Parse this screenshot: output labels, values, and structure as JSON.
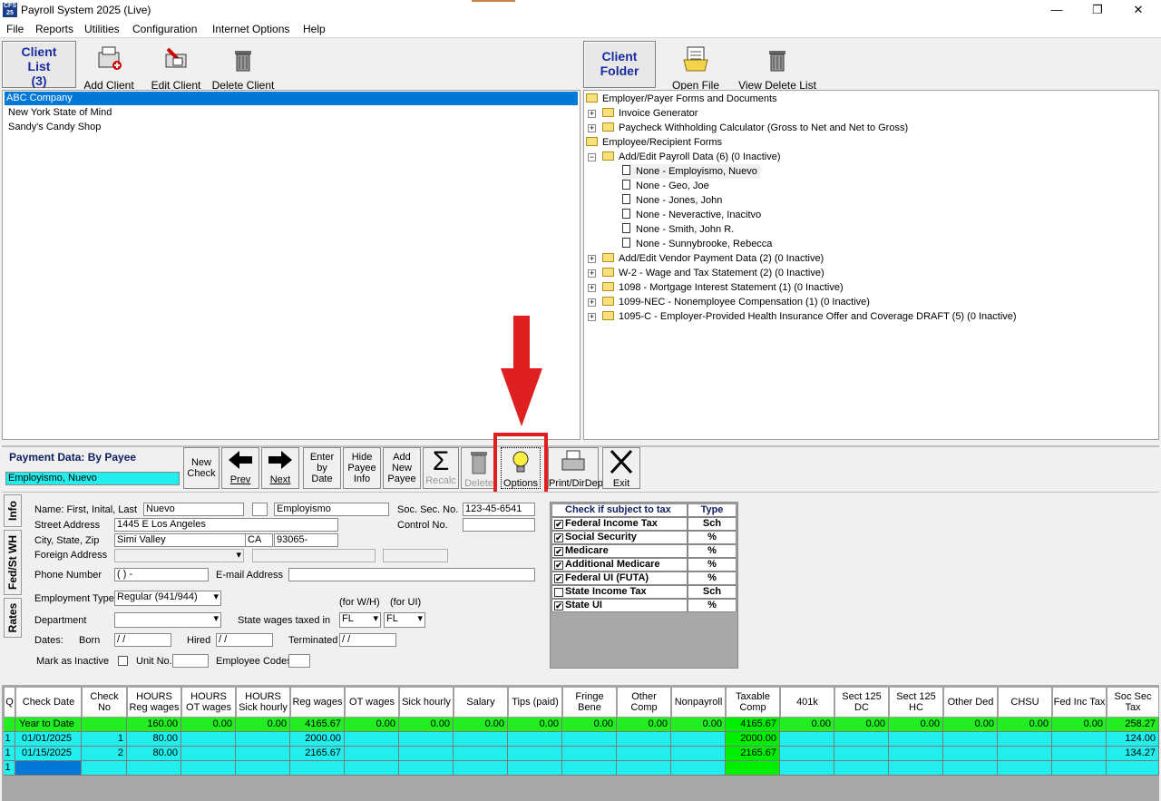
{
  "window": {
    "title": "Payroll System 2025 (Live)",
    "app_icon_text": "CFS 25",
    "minimize": "—",
    "maximize": "❐",
    "close": "✕"
  },
  "menu": [
    "File",
    "Reports",
    "Utilities",
    "Configuration",
    "Internet Options",
    "Help"
  ],
  "client_toolbar": {
    "tab_line1": "Client",
    "tab_line2": "List",
    "tab_count": "(3)",
    "add": "Add Client",
    "edit": "Edit Client",
    "delete": "Delete Client"
  },
  "clients": [
    "ABC Company",
    "New York State of Mind",
    "Sandy's Candy Shop"
  ],
  "folder_toolbar": {
    "tab_line1": "Client",
    "tab_line2": "Folder",
    "open": "Open File",
    "view_delete": "View Delete List"
  },
  "tree": {
    "employer_forms": "Employer/Payer Forms and Documents",
    "invoice": "Invoice Generator",
    "paycheck_calc": "Paycheck Withholding Calculator (Gross to Net and Net to Gross)",
    "employee_forms": "Employee/Recipient Forms",
    "payroll_data": "Add/Edit Payroll Data  (6) (0 Inactive)",
    "employees": [
      "None - Employismo, Nuevo",
      "None - Geo, Joe",
      "None - Jones, John",
      "None - Neveractive, Inacitvo",
      "None - Smith, John R.",
      "None - Sunnybrooke, Rebecca"
    ],
    "vendor": "Add/Edit Vendor Payment Data  (2) (0 Inactive)",
    "w2": "W-2 - Wage and Tax Statement  (2) (0 Inactive)",
    "f1098": "1098 - Mortgage Interest Statement  (1) (0 Inactive)",
    "f1099": "1099-NEC - Nonemployee Compensation  (1) (0 Inactive)",
    "f1095": "1095-C - Employer-Provided Health Insurance Offer and Coverage DRAFT  (5) (0 Inactive)"
  },
  "payment": {
    "header": "Payment Data: By Payee",
    "selected_payee": "Employismo, Nuevo",
    "buttons": {
      "new_check": [
        "New",
        "Check"
      ],
      "prev": "Prev",
      "next": "Next",
      "enter_by_date": [
        "Enter",
        "by",
        "Date"
      ],
      "hide_payee": [
        "Hide",
        "Payee",
        "Info"
      ],
      "add_payee": [
        "Add",
        "New",
        "Payee"
      ],
      "recalc": "Recalc",
      "delete": "Delete",
      "options": "Options",
      "print": "Print/DirDep",
      "exit": "Exit"
    }
  },
  "side_tabs": [
    "Info",
    "Fed/St WH",
    "Rates"
  ],
  "form": {
    "name_label": "Name: First, Inital, Last",
    "first": "Nuevo",
    "middle": "",
    "last": "Employismo",
    "ssn_label": "Soc. Sec. No.",
    "ssn": "123-45-6541",
    "street_label": "Street Address",
    "street": "1445 E Los Angeles",
    "control_label": "Control No.",
    "control": "",
    "csz_label": "City, State, Zip",
    "city": "Simi Valley",
    "state": "CA",
    "zip": "93065-",
    "foreign_label": "Foreign Address",
    "phone_label": "Phone Number",
    "phone": "(  )    -",
    "email_label": "E-mail Address",
    "email": "",
    "emp_type_label": "Employment Type",
    "emp_type": "Regular (941/944)",
    "for_wh": "(for W/H)",
    "for_ui": "(for UI)",
    "dept_label": "Department",
    "dept": "",
    "state_taxed_label": "State wages taxed in",
    "state_wh": "FL",
    "state_ui": "FL",
    "dates_label": "Dates:",
    "born_label": "Born",
    "born": " / /",
    "hired_label": "Hired",
    "hired": " / /",
    "term_label": "Terminated",
    "term": " / /",
    "inactive_label": "Mark as Inactive",
    "unit_label": "Unit No.",
    "emp_codes_label": "Employee Codes"
  },
  "tax_table": {
    "header_name": "Check if subject to tax",
    "header_type": "Type",
    "rows": [
      {
        "name": "Federal Income Tax",
        "type": "Sch",
        "checked": "✔"
      },
      {
        "name": "Social Security",
        "type": "%",
        "checked": "✔"
      },
      {
        "name": "Medicare",
        "type": "%",
        "checked": "✔"
      },
      {
        "name": "Additional Medicare",
        "type": "%",
        "checked": "✔"
      },
      {
        "name": "Federal UI (FUTA)",
        "type": "%",
        "checked": "✔"
      },
      {
        "name": "State Income Tax",
        "type": "Sch",
        "checked": ""
      },
      {
        "name": "State UI",
        "type": "%",
        "checked": "✔"
      }
    ]
  },
  "grid": {
    "headers": [
      "Q",
      "Check Date",
      "Check No",
      "HOURS Reg wages",
      "HOURS OT wages",
      "HOURS Sick hourly",
      "Reg wages",
      "OT wages",
      "Sick hourly",
      "Salary",
      "Tips (paid)",
      "Fringe Bene",
      "Other Comp",
      "Nonpayroll",
      "Taxable Comp",
      "401k",
      "Sect 125 DC",
      "Sect 125 HC",
      "Other Ded",
      "CHSU",
      "Fed Inc Tax",
      "Soc Sec Tax"
    ],
    "rows": [
      [
        "",
        "Year to Date",
        "",
        "160.00",
        "0.00",
        "0.00",
        "4165.67",
        "0.00",
        "0.00",
        "0.00",
        "0.00",
        "0.00",
        "0.00",
        "0.00",
        "4165.67",
        "0.00",
        "0.00",
        "0.00",
        "0.00",
        "0.00",
        "0.00",
        "258.27"
      ],
      [
        "1",
        "01/01/2025",
        "1",
        "80.00",
        "",
        "",
        "2000.00",
        "",
        "",
        "",
        "",
        "",
        "",
        "",
        "2000.00",
        "",
        "",
        "",
        "",
        "",
        "",
        "124.00"
      ],
      [
        "1",
        "01/15/2025",
        "2",
        "80.00",
        "",
        "",
        "2165.67",
        "",
        "",
        "",
        "",
        "",
        "",
        "",
        "2165.67",
        "",
        "",
        "",
        "",
        "",
        "",
        "134.27"
      ],
      [
        "1",
        "",
        "",
        "",
        "",
        "",
        "",
        "",
        "",
        "",
        "",
        "",
        "",
        "",
        "",
        "",
        "",
        "",
        "",
        "",
        "",
        ""
      ]
    ]
  },
  "colors": {
    "ytd_row": "#22ee22",
    "data_row": "#22eeee",
    "taxable_col": "#00ee00",
    "selection": "#0078d7",
    "annotation": "#e02020"
  }
}
